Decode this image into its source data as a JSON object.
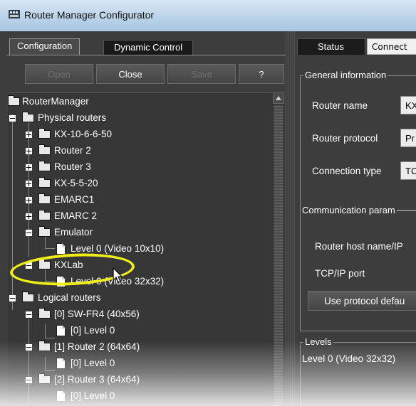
{
  "window": {
    "title": "Router Manager Configurator"
  },
  "left_panel": {
    "tabs": [
      {
        "label": "Configuration"
      },
      {
        "label": "Dynamic Control"
      }
    ],
    "buttons": {
      "open": "Open",
      "close": "Close",
      "save": "Save",
      "help": "?"
    },
    "tree": {
      "root": "RouterManager",
      "physical": "Physical routers",
      "physical_items": [
        "KX-10-6-6-50",
        "Router 2",
        "Router 3",
        "KX-5-5-20",
        "EMARC1",
        "EMARC 2"
      ],
      "emulator": "Emulator",
      "emulator_level": "Level 0 (Video 10x10)",
      "kxlab": "KXLab",
      "kxlab_level": "Level 0 (Video 32x32)",
      "logical": "Logical routers",
      "logical_items": [
        {
          "label": "[0] SW-FR4 (40x56)",
          "level": "[0] Level 0"
        },
        {
          "label": "[1] Router 2 (64x64)",
          "level": "[0] Level 0"
        },
        {
          "label": "[2] Router 3 (64x64)",
          "level": "[0] Level 0"
        }
      ]
    }
  },
  "right_panel": {
    "tabs": [
      {
        "label": "Status"
      },
      {
        "label": "Connect"
      }
    ],
    "general": {
      "legend": "General information",
      "router_name_label": "Router name",
      "router_name_value": "KX",
      "protocol_label": "Router protocol",
      "protocol_value": "Pr",
      "connection_label": "Connection type",
      "connection_value": "TC"
    },
    "communication": {
      "legend": "Communication param",
      "host_label": "Router host name/IP",
      "port_label": "TCP/IP port",
      "defaults_button": "Use protocol defau"
    },
    "levels": {
      "legend": "Levels",
      "item": "Level 0 (Video 32x32)"
    }
  },
  "colors": {
    "highlight": "#f0ec18",
    "panel": "#3d3d3d",
    "tree_bg": "#373737"
  }
}
